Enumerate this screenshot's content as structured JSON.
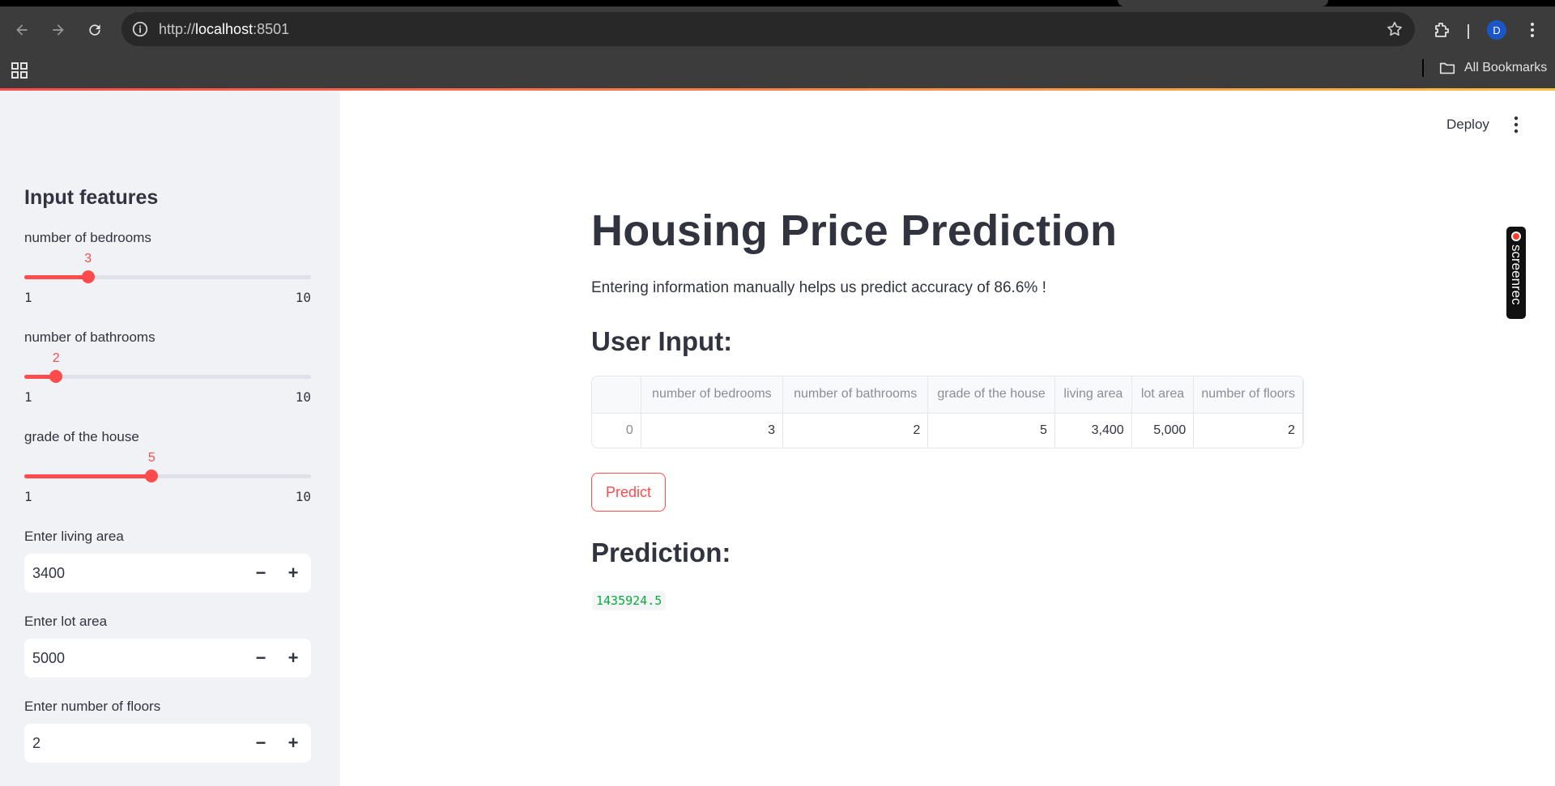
{
  "browser": {
    "url_scheme": "http://",
    "url_host": "localhost",
    "url_port": ":8501",
    "profile_initial": "D",
    "bookmarks_label": "All Bookmarks"
  },
  "app": {
    "deploy_label": "Deploy"
  },
  "sidebar": {
    "header": "Input features",
    "sliders": [
      {
        "label": "number of bedrooms",
        "value": "3",
        "min": "1",
        "max": "10"
      },
      {
        "label": "number of bathrooms",
        "value": "2",
        "min": "1",
        "max": "10"
      },
      {
        "label": "grade of the house",
        "value": "5",
        "min": "1",
        "max": "10"
      }
    ],
    "inputs": [
      {
        "label": "Enter living area",
        "value": "3400"
      },
      {
        "label": "Enter lot area",
        "value": "5000"
      },
      {
        "label": "Enter number of floors",
        "value": "2"
      }
    ],
    "minus": "−",
    "plus": "+"
  },
  "main": {
    "title": "Housing Price Prediction",
    "intro": "Entering information manually helps us predict accuracy of 86.6% !",
    "user_input_heading": "User Input:",
    "table": {
      "columns": [
        "",
        "number of bedrooms",
        "number of bathrooms",
        "grade of the house",
        "living area",
        "lot area",
        "number of floors"
      ],
      "rows": [
        [
          "0",
          "3",
          "2",
          "5",
          "3,400",
          "5,000",
          "2"
        ]
      ]
    },
    "predict_label": "Predict",
    "prediction_heading": "Prediction:",
    "prediction_value": "1435924.5"
  },
  "overlay": {
    "screenrec_label": "screenrec"
  },
  "colors": {
    "accent": "#ff4b4b",
    "result_green": "#09ab3b",
    "sidebar_bg": "#f0f2f6",
    "text": "#31333f"
  }
}
